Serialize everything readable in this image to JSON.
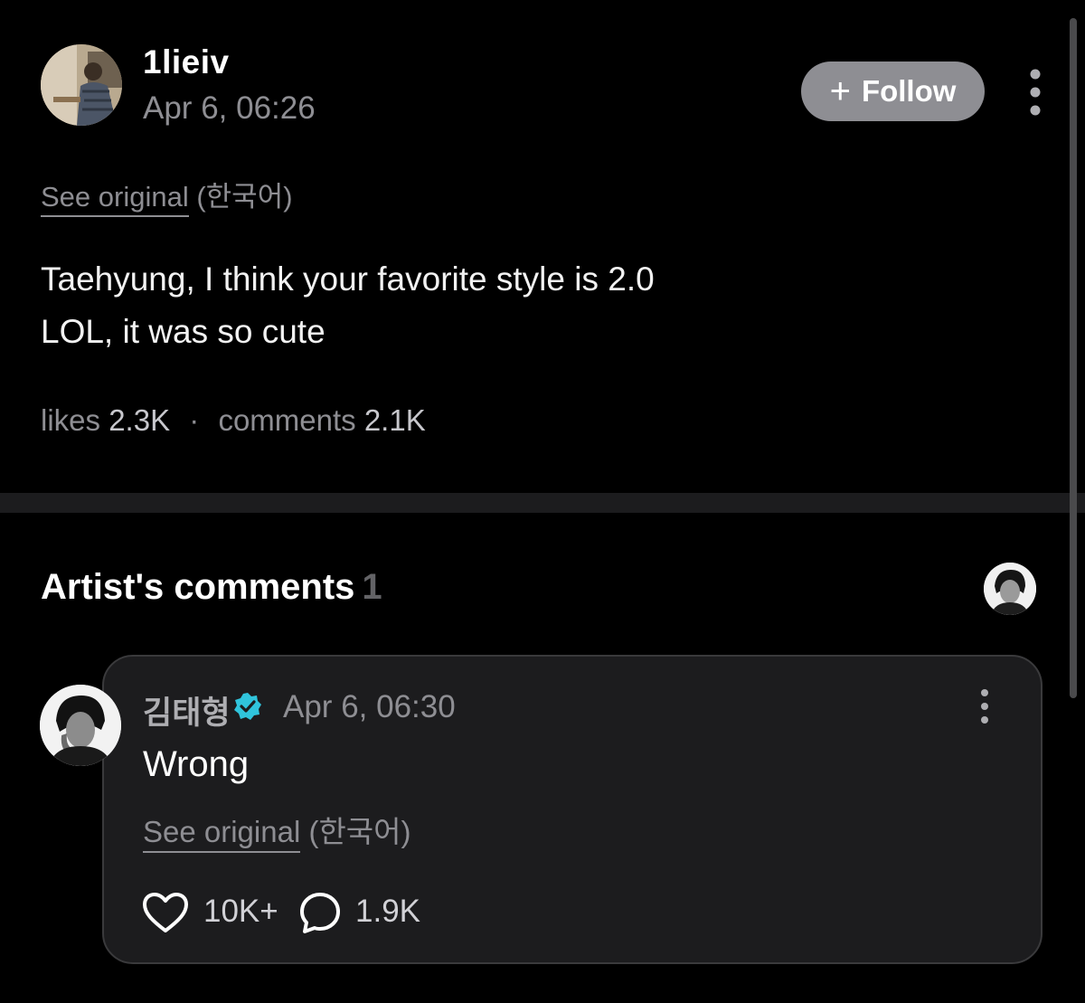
{
  "post": {
    "username": "1lieiv",
    "timestamp": "Apr 6, 06:26",
    "follow_label": "Follow",
    "see_original": "See original",
    "original_lang": "(한국어)",
    "body_line1": "Taehyung, I think your favorite style is 2.0",
    "body_line2": "LOL, it was so cute",
    "likes_label": "likes",
    "likes_value": "2.3K",
    "separator": "·",
    "comments_label": "comments",
    "comments_value": "2.1K"
  },
  "artist_section": {
    "title": "Artist's comments",
    "count": "1"
  },
  "comment": {
    "author": "김태형",
    "timestamp": "Apr 6, 06:30",
    "text": "Wrong",
    "see_original": "See original",
    "original_lang": "(한국어)",
    "likes_value": "10K+",
    "replies_value": "1.9K"
  },
  "icons": {
    "follow": "plus-icon",
    "more": "more-vertical-icon",
    "verified": "verified-badge-icon",
    "like": "heart-icon",
    "reply": "comment-bubble-icon"
  },
  "colors": {
    "background": "#000000",
    "card": "#1c1c1e",
    "muted_text": "#8e8e93",
    "follow_button": "#8e8e93",
    "verified_badge": "#30c4dc"
  }
}
